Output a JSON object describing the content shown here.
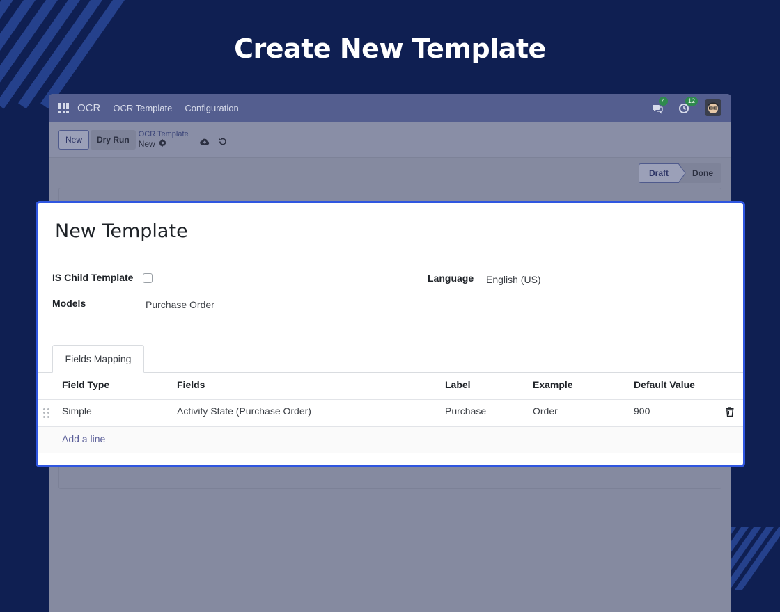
{
  "hero": {
    "title": "Create New Template"
  },
  "navbar": {
    "brand": "OCR",
    "links": [
      "OCR Template",
      "Configuration"
    ],
    "messages_count": "4",
    "activities_count": "12"
  },
  "control": {
    "new_label": "New",
    "dry_run_label": "Dry Run",
    "breadcrumb_parent": "OCR Template",
    "breadcrumb_current": "New"
  },
  "status": {
    "draft": "Draft",
    "done": "Done"
  },
  "form": {
    "title": "New Template",
    "is_child_label": "IS Child Template",
    "is_child_checked": false,
    "models_label": "Models",
    "models_value": "Purchase Order",
    "language_label": "Language",
    "language_value": "English (US)"
  },
  "tabs": {
    "fields_mapping": "Fields Mapping"
  },
  "table": {
    "headers": [
      "Field Type",
      "Fields",
      "Label",
      "Example",
      "Default Value"
    ],
    "rows": [
      {
        "field_type": "Simple",
        "fields": "Activity State (Purchase Order)",
        "label": "Purchase",
        "example": "Order",
        "default_value": "900"
      }
    ],
    "add_line": "Add a line"
  },
  "colors": {
    "background": "#0f1f52",
    "navbar": "#545e8f",
    "card_border": "#2f56e0",
    "badge": "#2f8a4e"
  },
  "icons": [
    "apps-grid-icon",
    "chat-icon",
    "clock-icon",
    "gear-icon",
    "cloud-upload-icon",
    "undo-icon",
    "drag-handle-icon",
    "trash-icon"
  ]
}
